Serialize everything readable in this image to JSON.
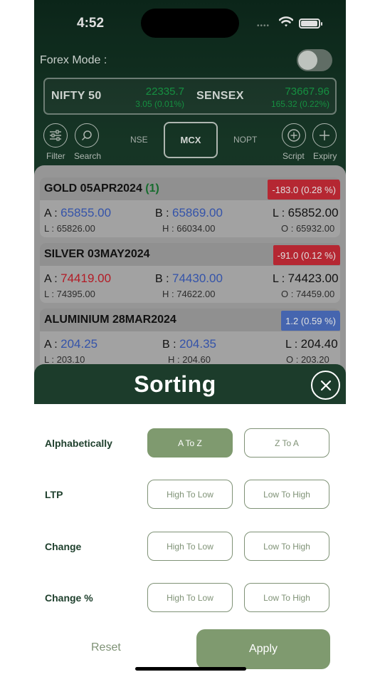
{
  "status": {
    "time": "4:52"
  },
  "forex": {
    "label": "Forex Mode :",
    "on": false
  },
  "indices": [
    {
      "name": "NIFTY 50",
      "value": "22335.7",
      "change": "3.05 (0.01%)"
    },
    {
      "name": "SENSEX",
      "value": "73667.96",
      "change": "165.32 (0.22%)"
    }
  ],
  "toolbar": {
    "filter": "Filter",
    "search": "Search",
    "segments": [
      "NSE",
      "MCX",
      "NOPT"
    ],
    "active_segment": "MCX",
    "script": "Script",
    "expiry": "Expiry"
  },
  "cards": [
    {
      "name": "GOLD 05APR2024",
      "count": "(1)",
      "badge": "-183.0 (0.28 %)",
      "badge_type": "neg",
      "a_label": "A :",
      "a": "65855.00",
      "b_label": "B :",
      "b": "65869.00",
      "l_label": "L :",
      "l": "65852.00",
      "low": "L : 65826.00",
      "high": "H : 66034.00",
      "open": "O : 65932.00"
    },
    {
      "name": "SILVER 03MAY2024",
      "count": "",
      "badge": "-91.0 (0.12 %)",
      "badge_type": "neg",
      "a_label": "A :",
      "a": "74419.00",
      "b_label": "B :",
      "b": "74430.00",
      "l_label": "L :",
      "l": "74423.00",
      "low": "L : 74395.00",
      "high": "H : 74622.00",
      "open": "O : 74459.00"
    },
    {
      "name": "ALUMINIUM 28MAR2024",
      "count": "",
      "badge": "1.2 (0.59 %)",
      "badge_type": "pos",
      "a_label": "A :",
      "a": "204.25",
      "b_label": "B :",
      "b": "204.35",
      "l_label": "L :",
      "l": "204.40",
      "low": "L : 203.10",
      "high": "H : 204.60",
      "open": "O : 203.20"
    }
  ],
  "sorting": {
    "title": "Sorting",
    "rows": [
      {
        "label": "Alphabetically",
        "options": [
          "A To Z",
          "Z To A"
        ],
        "selected": 0
      },
      {
        "label": "LTP",
        "options": [
          "High To Low",
          "Low To High"
        ],
        "selected": -1
      },
      {
        "label": "Change",
        "options": [
          "High To Low",
          "Low To High"
        ],
        "selected": -1
      },
      {
        "label": "Change %",
        "options": [
          "High To Low",
          "Low To High"
        ],
        "selected": -1
      }
    ],
    "reset": "Reset",
    "apply": "Apply"
  },
  "colors": {
    "brand_dark": "#1c3c2b",
    "accent": "#7f9a6f",
    "up": "#1aa34a",
    "down": "#cf2d3a",
    "bid_ask_blue": "#3c5fc1"
  }
}
